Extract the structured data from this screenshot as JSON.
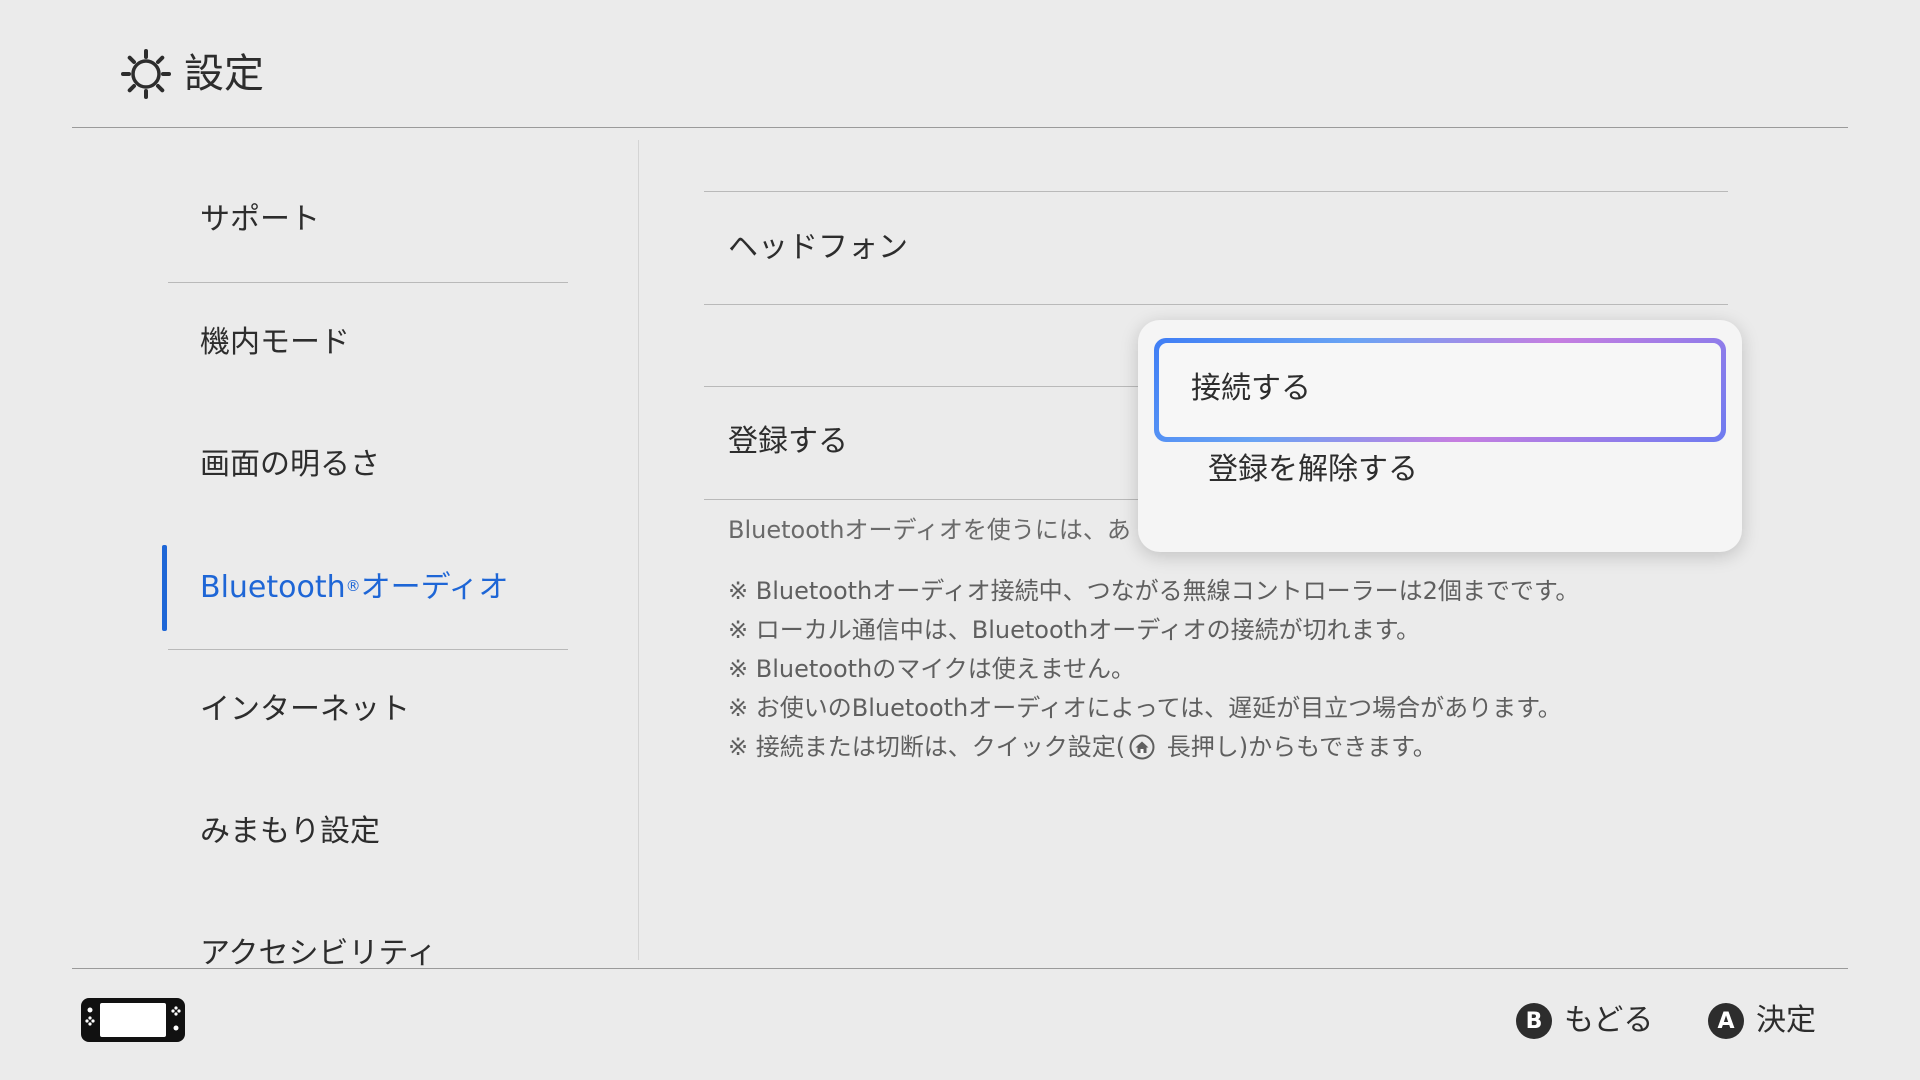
{
  "header": {
    "title": "設定",
    "icon": "gear-icon"
  },
  "sidebar": {
    "items": [
      {
        "label": "サポート"
      },
      {
        "label": "機内モード"
      },
      {
        "label": "画面の明るさ"
      },
      {
        "label": "Bluetooth",
        "sup": "®",
        "label_suffix": "オーディオ",
        "active": true
      },
      {
        "label": "インターネット"
      },
      {
        "label": "みまもり設定"
      },
      {
        "label": "アクセシビリティ"
      }
    ],
    "active_color": "#1e66d6"
  },
  "main": {
    "device_name": "ヘッドフォン",
    "register_label": "登録する",
    "description": "Bluetoothオーディオを使うには、あ",
    "notes": [
      "※ Bluetoothオーディオ接続中、つながる無線コントローラーは2個までです。",
      "※ ローカル通信中は、Bluetoothオーディオの接続が切れます。",
      "※ Bluetoothのマイクは使えません。",
      "※ お使いのBluetoothオーディオによっては、遅延が目立つ場合があります。"
    ],
    "note_last_prefix": "※ 接続または切断は、クイック設定(",
    "note_last_suffix": " 長押し)からもできます。"
  },
  "popup": {
    "items": [
      {
        "label": "接続する",
        "selected": true
      },
      {
        "label": "登録を解除する",
        "selected": false
      }
    ]
  },
  "footer": {
    "console_icon": "switch-console-icon",
    "buttons": [
      {
        "key": "B",
        "label": "もどる"
      },
      {
        "key": "A",
        "label": "決定"
      }
    ]
  }
}
